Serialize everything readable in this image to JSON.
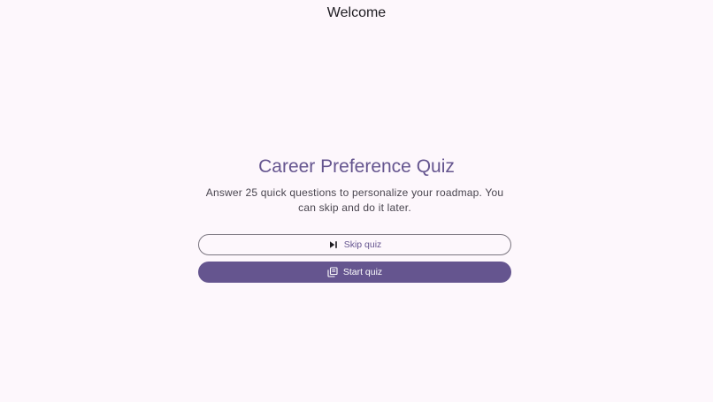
{
  "app_bar": {
    "title": "Welcome"
  },
  "quiz": {
    "title": "Career Preference Quiz",
    "description": "Answer 25 quick questions to personalize your roadmap. You can skip and do it later."
  },
  "actions": {
    "skip_label": "Skip quiz",
    "skip_icon": "skip-next-icon",
    "start_label": "Start quiz",
    "start_icon": "quiz-library-icon"
  },
  "colors": {
    "background": "#fdf7fc",
    "primary": "#65558f",
    "outline": "#7a757f",
    "on_surface": "#1d1b20",
    "on_surface_variant": "#49454f"
  }
}
